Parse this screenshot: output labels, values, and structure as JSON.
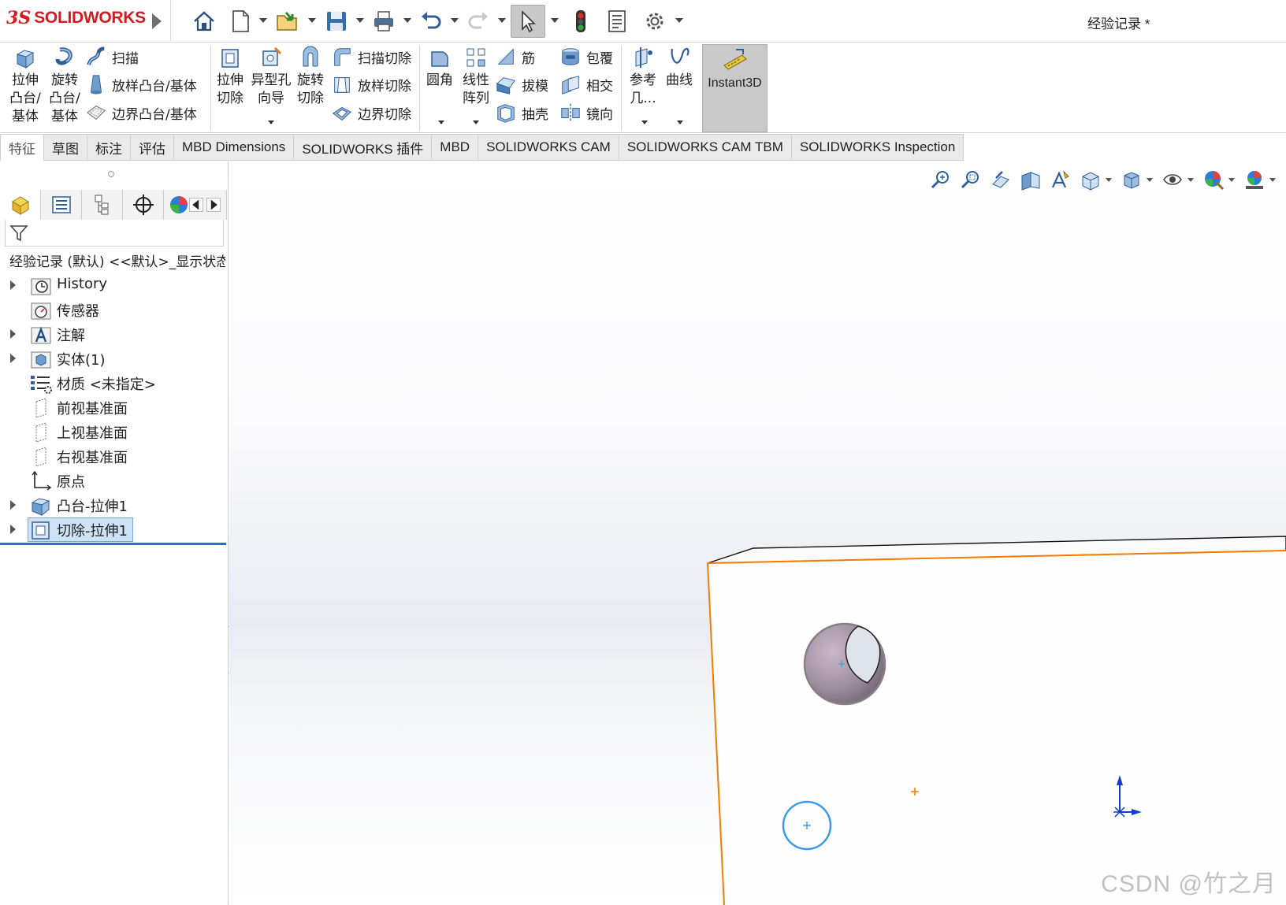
{
  "app": {
    "logo_ds": "3S",
    "logo_text": "SOLIDWORKS",
    "document_title": "经验记录 *"
  },
  "quick_access": {
    "icons": [
      "home-icon",
      "new-document-icon",
      "open-icon",
      "save-icon",
      "print-icon",
      "undo-icon",
      "redo-icon",
      "select-icon",
      "rebuild-icon",
      "file-properties-icon",
      "options-icon"
    ]
  },
  "ribbon": {
    "extrude_boss": "拉伸\n凸台/\n基体",
    "revolve_boss": "旋转\n凸台/\n基体",
    "sweep": "扫描",
    "loft_boss": "放样凸台/基体",
    "boundary_boss": "边界凸台/基体",
    "extrude_cut": "拉伸\n切除",
    "hole_wizard": "异型孔\n向导",
    "revolve_cut": "旋转\n切除",
    "sweep_cut": "扫描切除",
    "loft_cut": "放样切除",
    "boundary_cut": "边界切除",
    "fillet": "圆角",
    "linear_pattern": "线性\n阵列",
    "rib": "筋",
    "draft": "拔模",
    "shell": "抽壳",
    "wrap": "包覆",
    "intersect": "相交",
    "mirror": "镜向",
    "ref_geometry": "参考\n几...",
    "curves": "曲线",
    "instant3d": "Instant3D"
  },
  "tabs": [
    {
      "label": "特征",
      "active": true
    },
    {
      "label": "草图",
      "active": false
    },
    {
      "label": "标注",
      "active": false
    },
    {
      "label": "评估",
      "active": false
    },
    {
      "label": "MBD Dimensions",
      "active": false
    },
    {
      "label": "SOLIDWORKS 插件",
      "active": false
    },
    {
      "label": "MBD",
      "active": false
    },
    {
      "label": "SOLIDWORKS CAM",
      "active": false
    },
    {
      "label": "SOLIDWORKS CAM TBM",
      "active": false
    },
    {
      "label": "SOLIDWORKS Inspection",
      "active": false
    }
  ],
  "feature_tree": {
    "root": "经验记录 (默认) <<默认>_显示状态 1>",
    "items": [
      {
        "label": "History",
        "icon": "history-icon",
        "expandable": true,
        "selected": false
      },
      {
        "label": "传感器",
        "icon": "sensor-icon",
        "expandable": false,
        "selected": false
      },
      {
        "label": "注解",
        "icon": "annotation-icon",
        "expandable": true,
        "selected": false
      },
      {
        "label": "实体(1)",
        "icon": "solid-body-icon",
        "expandable": true,
        "selected": false
      },
      {
        "label": "材质 <未指定>",
        "icon": "material-icon",
        "expandable": false,
        "selected": false
      },
      {
        "label": "前视基准面",
        "icon": "plane-icon",
        "expandable": false,
        "selected": false
      },
      {
        "label": "上视基准面",
        "icon": "plane-icon",
        "expandable": false,
        "selected": false
      },
      {
        "label": "右视基准面",
        "icon": "plane-icon",
        "expandable": false,
        "selected": false
      },
      {
        "label": "原点",
        "icon": "origin-icon",
        "expandable": false,
        "selected": false
      },
      {
        "label": "凸台-拉伸1",
        "icon": "boss-extrude-icon",
        "expandable": true,
        "selected": false
      },
      {
        "label": "切除-拉伸1",
        "icon": "cut-extrude-icon",
        "expandable": true,
        "selected": true
      }
    ]
  },
  "view_toolbar": {
    "icons": [
      "zoom-to-fit-icon",
      "zoom-to-area-icon",
      "previous-view-icon",
      "section-view-icon",
      "dynamic-annotation-icon",
      "view-orientation-icon",
      "display-style-icon",
      "hide-show-icon",
      "edit-appearance-icon",
      "apply-scene-icon",
      "view-settings-icon"
    ]
  },
  "watermark": "CSDN @竹之月",
  "colors": {
    "selected_edge": "#f57c00",
    "sketch_circle": "#3d9be9",
    "accent": "#d71920"
  }
}
